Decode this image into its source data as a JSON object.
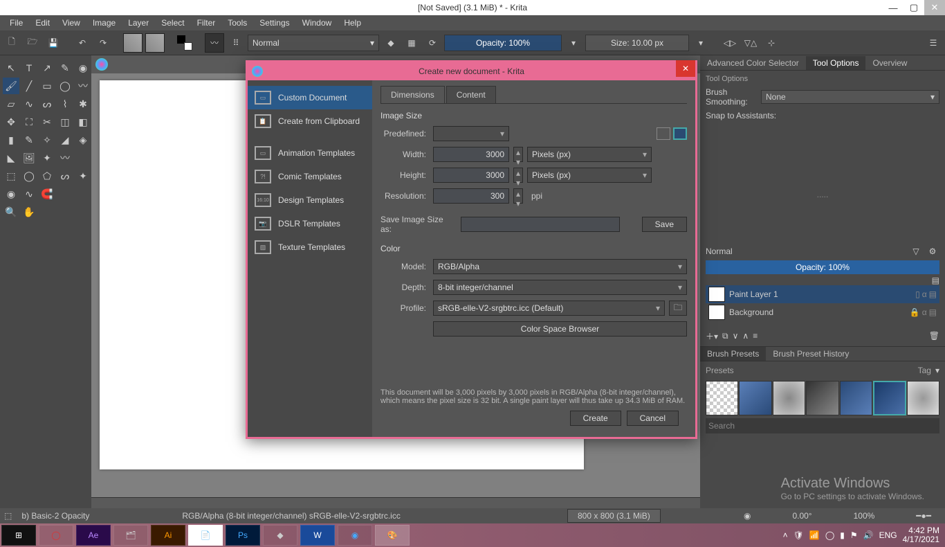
{
  "titlebar": {
    "title": "[Not Saved]  (3.1 MiB)  * - Krita"
  },
  "menubar": [
    "File",
    "Edit",
    "View",
    "Image",
    "Layer",
    "Select",
    "Filter",
    "Tools",
    "Settings",
    "Window",
    "Help"
  ],
  "toolbar": {
    "blend_mode": "Normal",
    "opacity_label": "Opacity: 100%",
    "size_label": "Size: 10.00 px"
  },
  "right": {
    "tabs": [
      "Advanced Color Selector",
      "Tool Options",
      "Overview"
    ],
    "tool_options_title": "Tool Options",
    "smoothing_label": "Brush Smoothing:",
    "smoothing_value": "None",
    "assistants_label": "Snap to Assistants:",
    "layer_blend": "Normal",
    "layer_opacity": "Opacity:  100%",
    "layers": [
      {
        "name": "Paint Layer 1",
        "active": true
      },
      {
        "name": "Background",
        "active": false
      }
    ],
    "preset_tabs": [
      "Brush Presets",
      "Brush Preset History"
    ],
    "presets_label": "Presets",
    "tag_label": "Tag",
    "search_placeholder": "Search"
  },
  "statusbar": {
    "brush": "b) Basic-2 Opacity",
    "profile": "RGB/Alpha (8-bit integer/channel)  sRGB-elle-V2-srgbtrc.icc",
    "dims": "800 x 800 (3.1 MiB)",
    "angle": "0.00°",
    "zoom": "100%"
  },
  "taskbar": {
    "lang": "ENG",
    "time": "4:42 PM",
    "date": "4/17/2021"
  },
  "watermark": {
    "line1": "Activate Windows",
    "line2": "Go to PC settings to activate Windows."
  },
  "dialog": {
    "title": "Create new document - Krita",
    "sidebar": [
      "Custom Document",
      "Create from Clipboard",
      "Animation Templates",
      "Comic Templates",
      "Design Templates",
      "DSLR Templates",
      "Texture Templates"
    ],
    "tabs": [
      "Dimensions",
      "Content"
    ],
    "image_size_title": "Image Size",
    "predefined_label": "Predefined:",
    "width_label": "Width:",
    "width_value": "3000",
    "width_unit": "Pixels (px)",
    "height_label": "Height:",
    "height_value": "3000",
    "height_unit": "Pixels (px)",
    "resolution_label": "Resolution:",
    "resolution_value": "300",
    "resolution_unit": "ppi",
    "save_size_label": "Save Image Size as:",
    "save_btn": "Save",
    "color_title": "Color",
    "model_label": "Model:",
    "model_value": "RGB/Alpha",
    "depth_label": "Depth:",
    "depth_value": "8-bit integer/channel",
    "profile_label": "Profile:",
    "profile_value": "sRGB-elle-V2-srgbtrc.icc (Default)",
    "browser_btn": "Color Space Browser",
    "info": "This document will be 3,000 pixels by 3,000 pixels in RGB/Alpha (8-bit integer/channel), which means the pixel size is 32 bit. A single paint layer will thus take up 34.3 MiB of RAM.",
    "create_btn": "Create",
    "cancel_btn": "Cancel"
  }
}
